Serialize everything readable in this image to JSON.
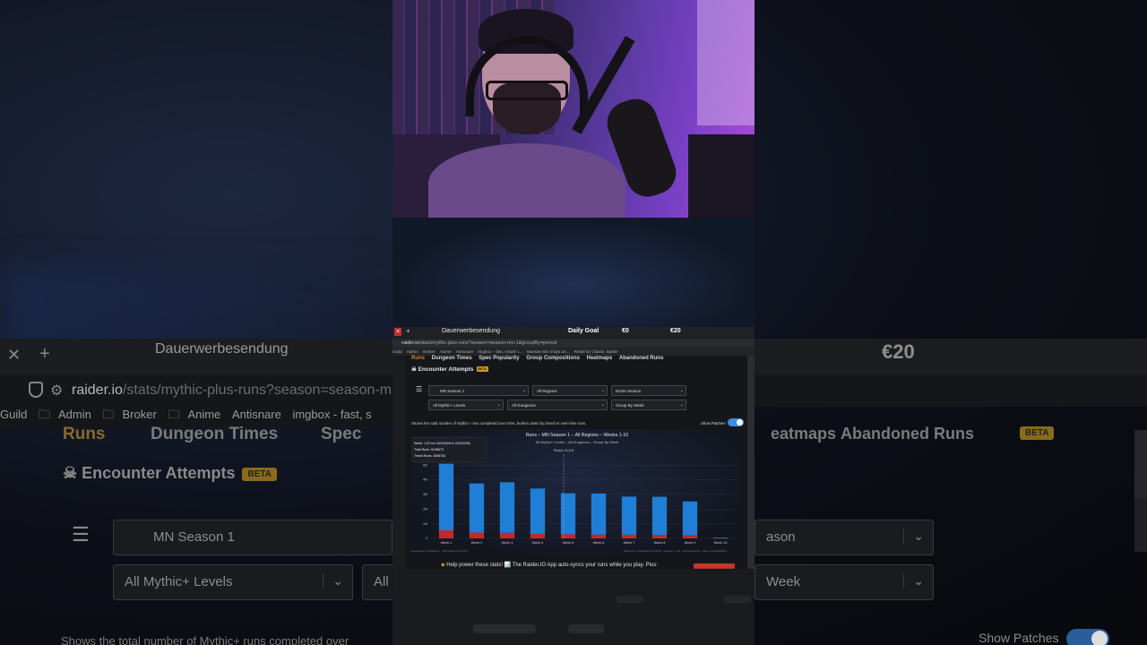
{
  "stream": {
    "tab_title": "Dauerwerbesendung",
    "overlay": {
      "goal_label": "Daily Goal",
      "start": "€0",
      "target": "€20"
    }
  },
  "browser": {
    "url_host": "raider.io",
    "url_path": "/stats/mythic-plus-runs?season=season-mn-1&groupBy=period",
    "url_path_bg": "/stats/mythic-plus-runs?season=season-mn-1",
    "bookmarks": [
      "Guild",
      "Admin",
      "Broker",
      "Anime",
      "Antisnare",
      "imgbox - fast, s"
    ],
    "bookmarks_small": [
      "Guild",
      "Admin",
      "Broker",
      "Anime",
      "Antisnare",
      "imgbox – fast, simple i...",
      "Massive list of tips an...",
      "Retail for Classic Spider"
    ]
  },
  "page": {
    "nav": {
      "runs": "Runs",
      "dungeon_times": "Dungeon Times",
      "spec_popularity": "Spec Popularity",
      "spec_short": "Spec",
      "group_compositions": "Group Compositions",
      "heatmaps": "Heatmaps",
      "heatmaps_partial": "eatmaps",
      "abandoned_runs": "Abandoned Runs",
      "beta": "BETA"
    },
    "encounter_attempts": "Encounter Attempts",
    "beta_badge": "BETA",
    "filters": {
      "season": "MN Season 1",
      "region": "All Regions",
      "period": "Entire Season",
      "period_partial": "ason",
      "levels": "All Mythic+ Levels",
      "levels_partial": "All I",
      "dungeons": "All Dungeons",
      "group_by": "Group By Week",
      "group_by_partial": "Week"
    },
    "description": "Shows the total number of Mythic+ runs completed over time, broken down by timed vs over-time runs.",
    "description_partial": "Shows the total number of Mythic+ runs completed over",
    "show_patches": "Show Patches",
    "help_text": "Help power these stats! 📊 The Raider.IO App auto-syncs your runs while you play. Plus:",
    "footer_left": "Generated by Raider.IO · 3/17/2026 11:00 UTC",
    "footer_right": "Data from 1 DAU/300+ K/17/36 · Season 1 · All · (all Dungeons) · Data: 17/36/4026/26"
  },
  "chart_data": {
    "type": "bar",
    "title": "Runs – MN Season 1 – All Regions – Weeks 1-10",
    "subtitle": "All Mythic+ Levels – All Dungeons – Group By Week",
    "patch_label": "Patch 12.0.5",
    "categories": [
      "Week 1",
      "Week 2",
      "Week 3",
      "Week 4",
      "Week 5",
      "Week 6",
      "Week 7",
      "Week 8",
      "Week 9",
      "Week 10"
    ],
    "y_ticks": [
      "0",
      "1M",
      "2M",
      "3M",
      "4M",
      "5M"
    ],
    "ylim": [
      0,
      5.5
    ],
    "series": [
      {
        "name": "Timed Runs",
        "color": "#1f7fd6",
        "values": [
          4.55,
          3.35,
          3.45,
          3.1,
          2.8,
          2.8,
          2.6,
          2.6,
          2.3,
          0.05
        ]
      },
      {
        "name": "Over Time",
        "color": "#c9262b",
        "values": [
          0.55,
          0.4,
          0.38,
          0.3,
          0.28,
          0.26,
          0.25,
          0.24,
          0.22,
          0.01
        ]
      }
    ],
    "tooltip": {
      "week": "Week: 1 (From 3/24/2026 to 3/31/2026)",
      "total": "Total Runs: 5198673",
      "timed": "Timed Runs: 4598762"
    }
  }
}
